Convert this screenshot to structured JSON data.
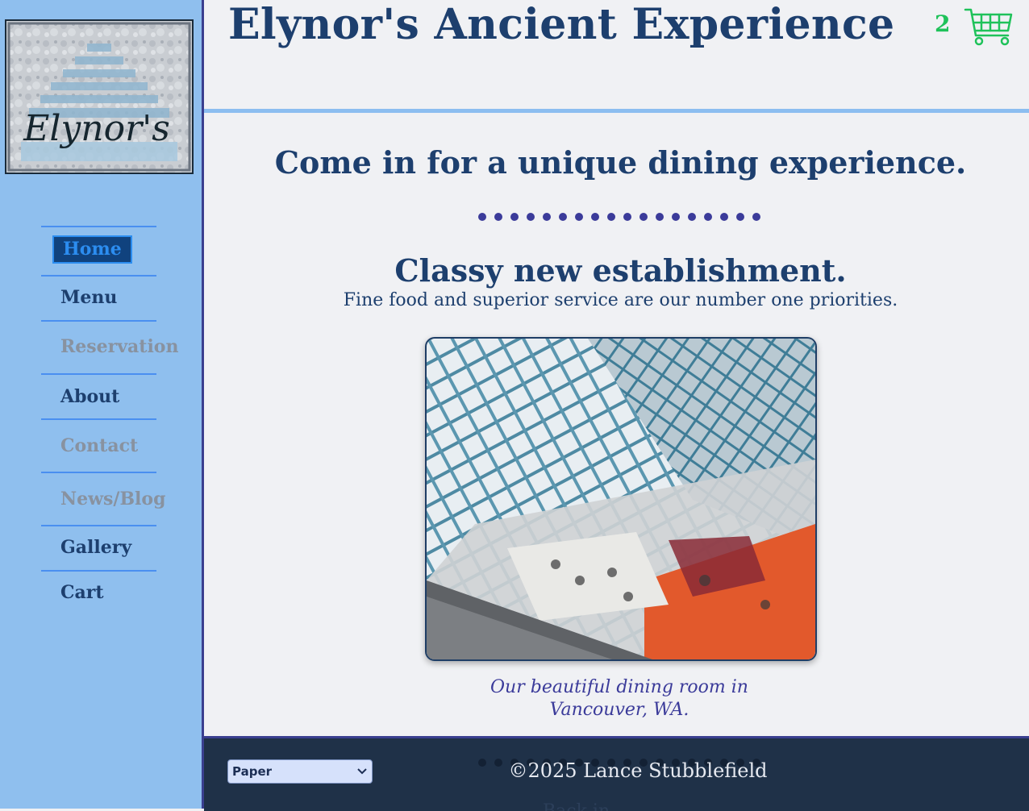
{
  "site": {
    "title": "Elynor's Ancient Experience",
    "logo_text": "Elynor's"
  },
  "cart": {
    "count": "2",
    "icon": "cart-icon",
    "color": "#1fc25a"
  },
  "nav": {
    "items": [
      {
        "label": "Home",
        "state": "active"
      },
      {
        "label": "Menu",
        "state": "normal"
      },
      {
        "label": "Reservation",
        "state": "disabled"
      },
      {
        "label": "About",
        "state": "normal"
      },
      {
        "label": "Contact",
        "state": "disabled"
      },
      {
        "label": "News/Blog",
        "state": "disabled"
      },
      {
        "label": "Gallery",
        "state": "normal"
      },
      {
        "label": "Cart",
        "state": "normal"
      }
    ]
  },
  "main": {
    "tagline": "Come in for a unique dining experience.",
    "heading": "Classy new establishment.",
    "subtext": "Fine food and superior service are our number one priorities.",
    "caption": "Our beautiful dining room in Vancouver, WA."
  },
  "footer": {
    "copyright": "©2025 Lance Stubblefield",
    "faded_text": "Back in",
    "theme_select": {
      "value": "Paper"
    }
  },
  "colors": {
    "sidebar": "#8fbfee",
    "heading": "#1d3f6e",
    "accent": "#3b3b9a",
    "footer": "#1f3148"
  }
}
